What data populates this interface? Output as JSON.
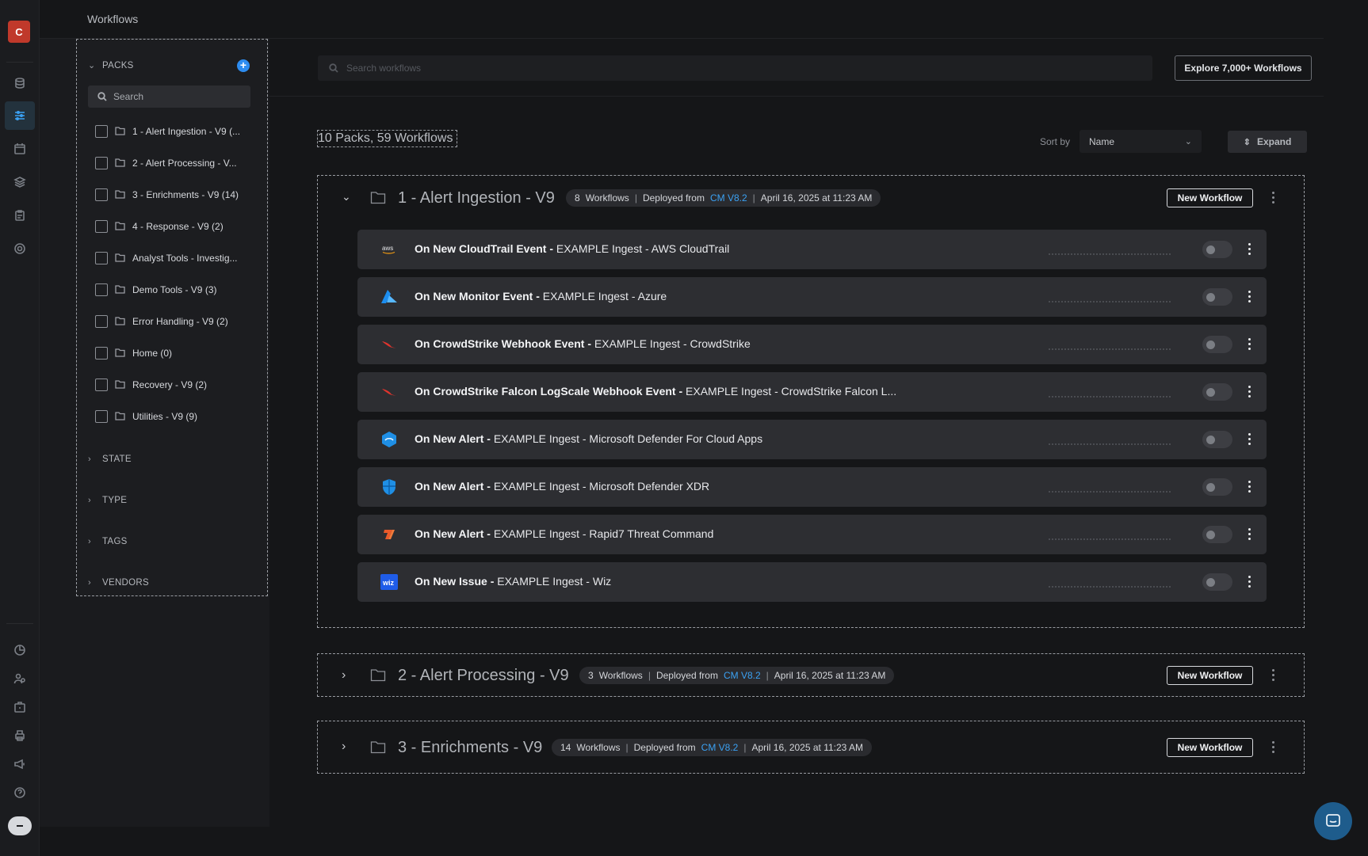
{
  "app": {
    "logo_letter": "C",
    "page_title": "Workflows"
  },
  "sidebar": {
    "packs_label": "PACKS",
    "search_placeholder": "Search",
    "packs": [
      "1 - Alert Ingestion - V9 (...",
      "2 - Alert Processing - V...",
      "3 - Enrichments - V9 (14)",
      "4 - Response - V9 (2)",
      "Analyst Tools - Investig...",
      "Demo Tools - V9 (3)",
      "Error Handling - V9 (2)",
      "Home (0)",
      "Recovery - V9 (2)",
      "Utilities - V9 (9)"
    ],
    "sections": [
      "STATE",
      "TYPE",
      "TAGS",
      "VENDORS"
    ]
  },
  "toolbar": {
    "search_placeholder": "Search workflows",
    "explore_label": "Explore 7,000+ Workflows",
    "count_label": "10 Packs, 59 Workflows",
    "sort_label": "Sort by",
    "sort_value": "Name",
    "expand_label": "Expand"
  },
  "packs": [
    {
      "title": "1 - Alert Ingestion - V9",
      "count": "8",
      "workflows_word": "Workflows",
      "deployed_from": "Deployed from",
      "cm_version": "CM V8.2",
      "date": "April 16, 2025 at 11:23 AM",
      "new_workflow_label": "New Workflow",
      "expanded": true,
      "workflows": [
        {
          "trigger": "On New CloudTrail Event -",
          "name": "EXAMPLE Ingest - AWS CloudTrail",
          "icon": "aws-icon"
        },
        {
          "trigger": "On New Monitor Event -",
          "name": "EXAMPLE Ingest - Azure",
          "icon": "azure-icon"
        },
        {
          "trigger": "On CrowdStrike Webhook Event -",
          "name": "EXAMPLE Ingest - CrowdStrike",
          "icon": "crowdstrike-icon"
        },
        {
          "trigger": "On CrowdStrike Falcon LogScale Webhook Event -",
          "name": "EXAMPLE Ingest - CrowdStrike Falcon L...",
          "icon": "crowdstrike-icon"
        },
        {
          "trigger": "On New Alert -",
          "name": "EXAMPLE Ingest - Microsoft Defender For Cloud Apps",
          "icon": "defender-cloud-apps-icon"
        },
        {
          "trigger": "On New Alert -",
          "name": "EXAMPLE Ingest - Microsoft Defender XDR",
          "icon": "defender-shield-icon"
        },
        {
          "trigger": "On New Alert -",
          "name": "EXAMPLE Ingest - Rapid7 Threat Command",
          "icon": "rapid7-icon"
        },
        {
          "trigger": "On New Issue -",
          "name": "EXAMPLE Ingest - Wiz",
          "icon": "wiz-icon"
        }
      ]
    },
    {
      "title": "2 - Alert Processing - V9",
      "count": "3",
      "workflows_word": "Workflows",
      "deployed_from": "Deployed from",
      "cm_version": "CM V8.2",
      "date": "April 16, 2025 at 11:23 AM",
      "new_workflow_label": "New Workflow",
      "expanded": false
    },
    {
      "title": "3 - Enrichments - V9",
      "count": "14",
      "workflows_word": "Workflows",
      "deployed_from": "Deployed from",
      "cm_version": "CM V8.2",
      "date": "April 16, 2025 at 11:23 AM",
      "new_workflow_label": "New Workflow",
      "expanded": false
    }
  ],
  "colors": {
    "accent": "#2d8cf0",
    "link": "#3ba1f3",
    "logo": "#c0392b"
  }
}
